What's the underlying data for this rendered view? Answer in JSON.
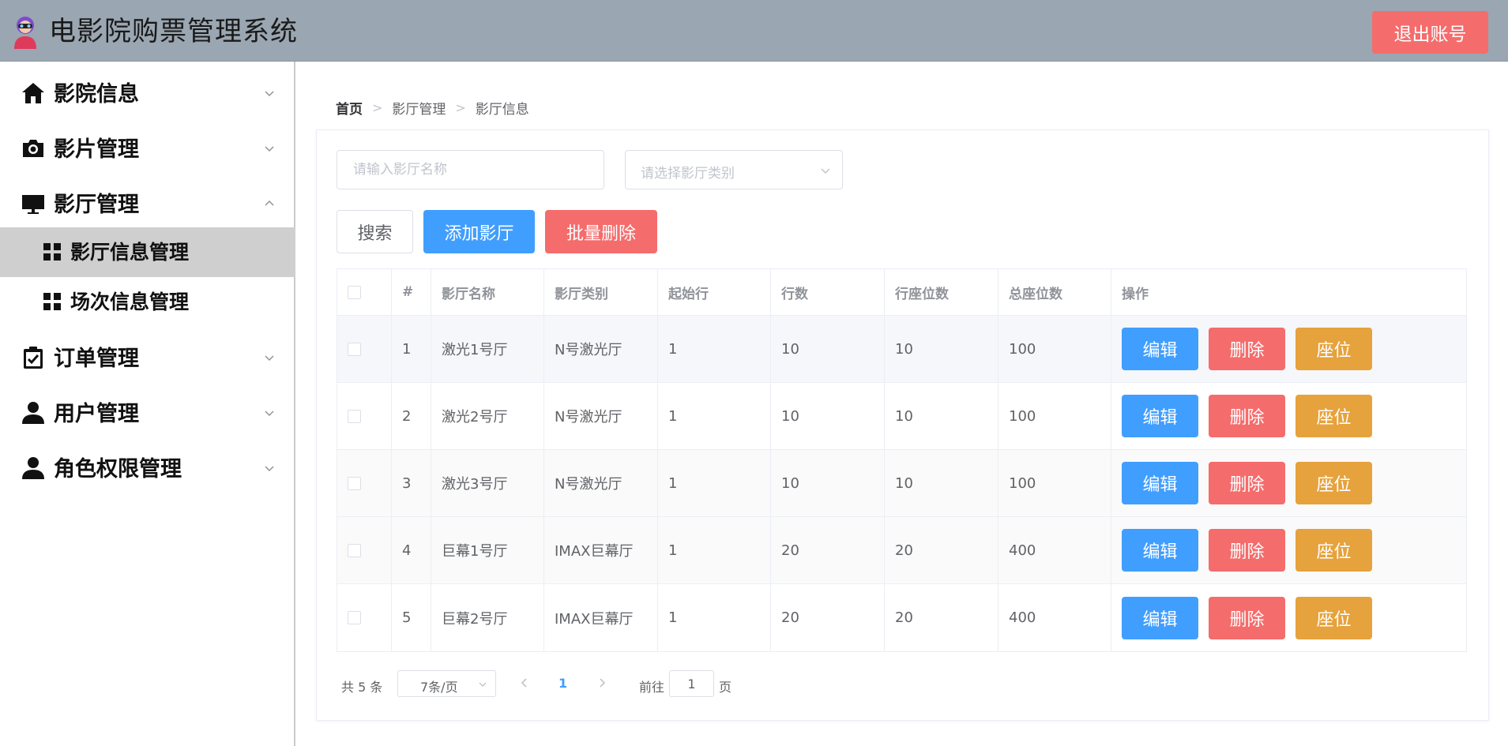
{
  "header": {
    "title": "电影院购票管理系统",
    "logout_label": "退出账号"
  },
  "sidebar": {
    "items": [
      {
        "label": "影院信息",
        "icon": "home-icon"
      },
      {
        "label": "影片管理",
        "icon": "camera-icon"
      },
      {
        "label": "影厅管理",
        "icon": "monitor-icon",
        "expanded": true
      },
      {
        "label": "订单管理",
        "icon": "clipboard-check-icon"
      },
      {
        "label": "用户管理",
        "icon": "user-icon"
      },
      {
        "label": "角色权限管理",
        "icon": "user-icon"
      }
    ],
    "sub_items": [
      {
        "label": "影厅信息管理",
        "active": true
      },
      {
        "label": "场次信息管理",
        "active": false
      }
    ]
  },
  "breadcrumb": [
    "首页",
    "影厅管理",
    "影厅信息"
  ],
  "filters": {
    "name_placeholder": "请输入影厅名称",
    "type_placeholder": "请选择影厅类别"
  },
  "toolbar": {
    "search_label": "搜索",
    "add_label": "添加影厅",
    "batch_delete_label": "批量删除"
  },
  "table": {
    "headers": [
      "#",
      "影厅名称",
      "影厅类别",
      "起始行",
      "行数",
      "行座位数",
      "总座位数",
      "操作"
    ],
    "rows": [
      {
        "id": "1",
        "name": "激光1号厅",
        "type": "N号激光厅",
        "start_row": "1",
        "rows": "10",
        "seats_per_row": "10",
        "total_seats": "100"
      },
      {
        "id": "2",
        "name": "激光2号厅",
        "type": "N号激光厅",
        "start_row": "1",
        "rows": "10",
        "seats_per_row": "10",
        "total_seats": "100"
      },
      {
        "id": "3",
        "name": "激光3号厅",
        "type": "N号激光厅",
        "start_row": "1",
        "rows": "10",
        "seats_per_row": "10",
        "total_seats": "100"
      },
      {
        "id": "4",
        "name": "巨幕1号厅",
        "type": "IMAX巨幕厅",
        "start_row": "1",
        "rows": "20",
        "seats_per_row": "20",
        "total_seats": "400"
      },
      {
        "id": "5",
        "name": "巨幕2号厅",
        "type": "IMAX巨幕厅",
        "start_row": "1",
        "rows": "20",
        "seats_per_row": "20",
        "total_seats": "400"
      }
    ],
    "op_labels": {
      "edit": "编辑",
      "delete": "删除",
      "seat": "座位"
    }
  },
  "pagination": {
    "total": "共 5 条",
    "page_size": "7条/页",
    "current_page": "1",
    "goto_prefix": "前往",
    "goto_value": "1",
    "goto_suffix": "页"
  },
  "colors": {
    "primary": "#409eff",
    "danger": "#f56c6c",
    "warning": "#e6a23c",
    "header_bg": "#9aa6b1"
  }
}
